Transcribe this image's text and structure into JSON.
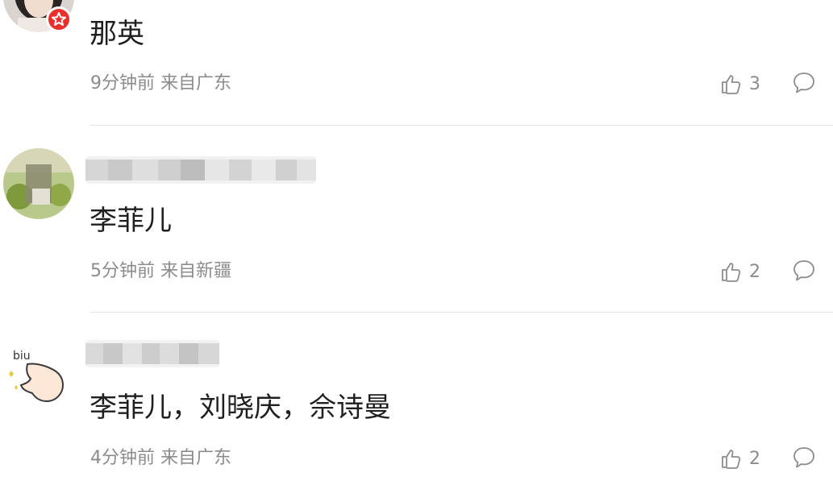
{
  "comments": [
    {
      "content": "那英",
      "time": "9分钟前",
      "location": "来自广东",
      "likes": "3",
      "avatar_icon": "user-photo-avatar",
      "has_badge": true,
      "badge_color": "#e8302d"
    },
    {
      "content": "李菲儿",
      "time": "5分钟前",
      "location": "来自新疆",
      "likes": "2",
      "avatar_icon": "user-photo-avatar"
    },
    {
      "content": "李菲儿，刘晓庆，佘诗曼",
      "time": "4分钟前",
      "location": "来自广东",
      "likes": "2",
      "avatar_icon": "biu-hand-avatar"
    }
  ],
  "icons": {
    "like": "thumbs-up-icon",
    "reply": "comment-bubble-icon"
  },
  "colors": {
    "meta_text": "#8c8c8c",
    "content_text": "#1f1f1f",
    "divider": "#e6e6e6"
  }
}
